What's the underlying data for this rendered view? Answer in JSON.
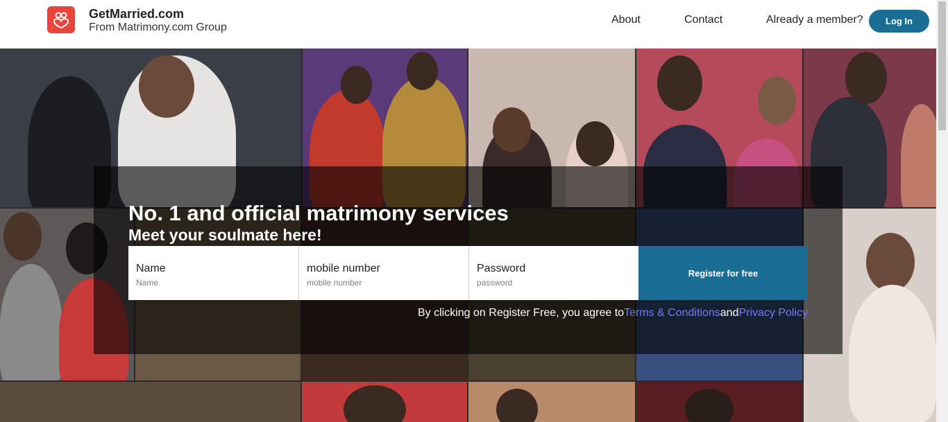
{
  "header": {
    "brand_name": "GetMarried.com",
    "brand_sub": "From Matrimony.com Group",
    "nav": {
      "about": "About",
      "contact": "Contact"
    },
    "member_text": "Already a member?",
    "login_label": "Log In"
  },
  "hero": {
    "title": "No. 1 and official matrimony services",
    "subtitle": "Meet your soulmate here!"
  },
  "form": {
    "name": {
      "label": "Name",
      "placeholder": "Name"
    },
    "mobile": {
      "label": "mobile number",
      "placeholder": "mobile number"
    },
    "password": {
      "label": "Password",
      "placeholder": "password"
    },
    "register_label": "Register for free",
    "terms_prefix": "By clicking on Register Free, you agree to",
    "terms_link": "Terms & Conditions",
    "terms_and": "and",
    "privacy_link": "Privacy Policy"
  },
  "colors": {
    "brand_red": "#e8453c",
    "primary_blue": "#1a6e95",
    "link_blue": "#6f7df7"
  },
  "icons": {
    "logo": "couple-heart-icon"
  }
}
